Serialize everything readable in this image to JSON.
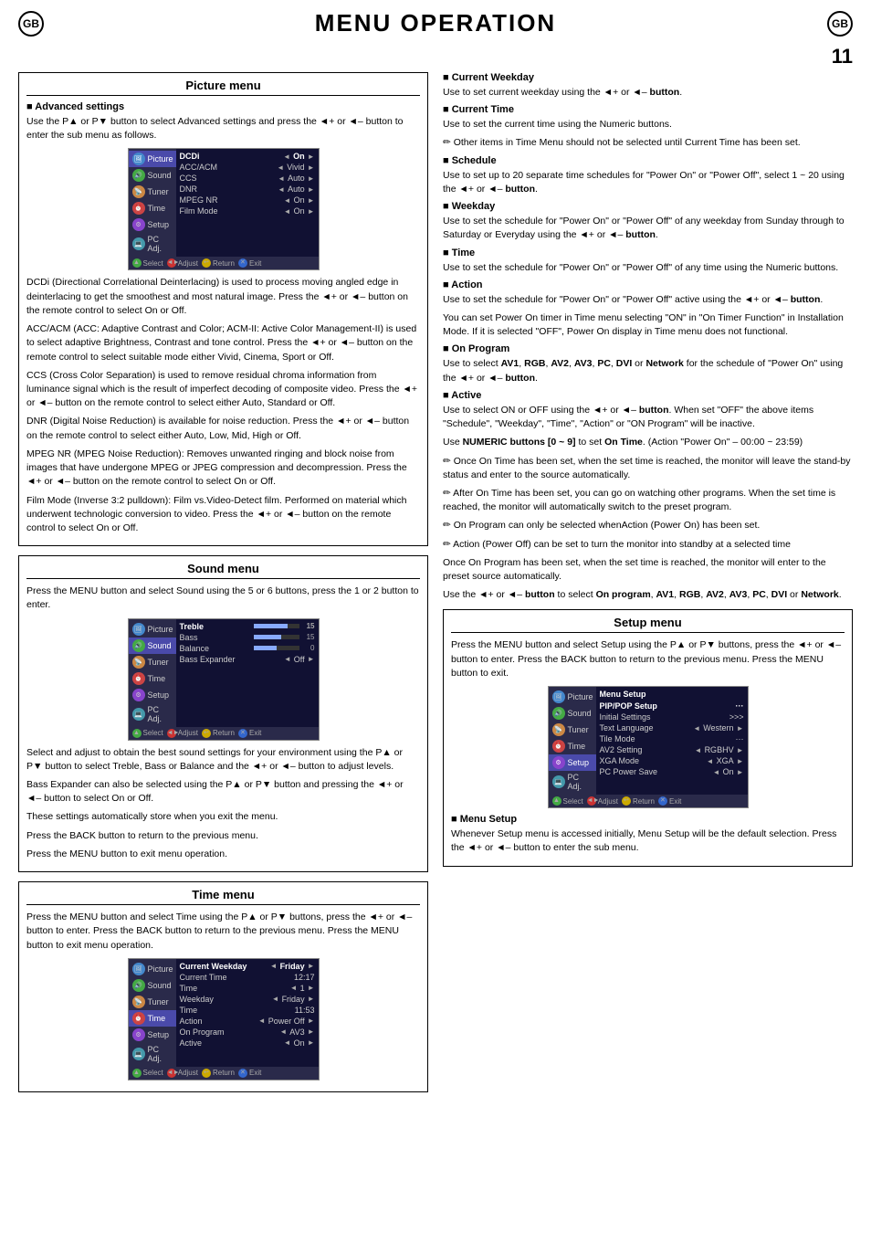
{
  "header": {
    "gb_label": "GB",
    "title": "MENU OPERATION",
    "page_number": "11"
  },
  "left_column": {
    "picture_menu": {
      "title": "Picture menu",
      "advanced_settings": {
        "heading": "Advanced settings",
        "intro": "Use the P▲ or P▼ button to select Advanced settings and press the ◄+ or ◄– button to enter the sub menu as follows.",
        "screenshot": {
          "active_tab": "Picture",
          "active_item": "DCDi",
          "rows": [
            {
              "label": "DCDi",
              "value": "On",
              "has_arrows": true
            },
            {
              "label": "ACC/ACM",
              "value": "Vivid",
              "has_arrows": true
            },
            {
              "label": "CCS",
              "value": "Auto",
              "has_arrows": true
            },
            {
              "label": "DNR",
              "value": "Auto",
              "has_arrows": true
            },
            {
              "label": "MPEG NR",
              "value": "On",
              "has_arrows": true
            },
            {
              "label": "Film Mode",
              "value": "On",
              "has_arrows": true
            }
          ]
        },
        "dcdi_text": "DCDi (Directional Correlational Deinterlacing) is used to process moving angled edge in deinterlacing to get the smoothest and most natural image. Press the ◄+ or ◄– button on the remote control to select On or Off.",
        "acc_acm_text": "ACC/ACM (ACC: Adaptive Contrast and Color; ACM-II: Active Color Management-II) is used to select adaptive Brightness, Contrast and tone control. Press the ◄+ or ◄– button on the remote control to select suitable mode either Vivid, Cinema, Sport or Off.",
        "ccs_text": "CCS (Cross Color Separation) is used to remove residual chroma information from luminance signal which is the result of imperfect decoding of composite video. Press the ◄+ or ◄– button on the remote control to select either Auto, Standard or Off.",
        "dnr_text": "DNR (Digital Noise Reduction) is available for noise reduction. Press the ◄+ or ◄– button on the remote control to select either Auto, Low, Mid, High or Off.",
        "mpeg_nr_text": "MPEG NR (MPEG Noise Reduction): Removes unwanted ringing and block noise from images that have undergone MPEG or JPEG compression and decompression. Press the ◄+ or ◄– button on the remote control to select On or Off.",
        "film_mode_text": "Film Mode (Inverse 3:2 pulldown): Film vs.Video-Detect film. Performed on material which underwent technologic conversion to video. Press the ◄+ or ◄– button on the remote control to select On or Off."
      }
    },
    "sound_menu": {
      "title": "Sound menu",
      "intro": "Press the MENU button and select Sound using the 5 or 6 buttons, press the 1 or 2 button to enter.",
      "screenshot": {
        "active_tab": "Sound",
        "rows": [
          {
            "label": "Treble",
            "bar": 75,
            "value": "15"
          },
          {
            "label": "Bass",
            "bar": 60,
            "value": "15"
          },
          {
            "label": "Balance",
            "bar": 50,
            "value": "0"
          },
          {
            "label": "Bass Expander",
            "value": "Off",
            "has_arrows": true
          }
        ]
      },
      "body_text": "Select and adjust to obtain the best sound settings for your environment using the P▲ or P▼ button to select Treble, Bass or Balance and the ◄+ or ◄– button to adjust levels.",
      "bass_expander_text": "Bass Expander can also be selected using the P▲ or P▼ button and pressing the ◄+ or ◄– button to select On or Off.",
      "auto_store_text": "These settings automatically store when you exit the menu.",
      "back_button_text": "Press the BACK button to return to the previous menu.",
      "menu_button_text": "Press the MENU button to exit menu operation."
    },
    "time_menu": {
      "title": "Time menu",
      "intro": "Press the MENU button and select Time using the P▲ or P▼ buttons, press the ◄+ or ◄– button to enter. Press the BACK button to return to the previous menu. Press the MENU button to exit menu operation.",
      "screenshot": {
        "active_tab": "Time",
        "rows": [
          {
            "label": "Current Weekday",
            "value": "Friday",
            "has_arrows": true
          },
          {
            "label": "Current Time",
            "value": "12:17"
          },
          {
            "label": "Time",
            "value": "1"
          },
          {
            "label": "Weekday",
            "value": "Friday",
            "has_arrows": true
          },
          {
            "label": "Time",
            "value": "11:53"
          },
          {
            "label": "Action",
            "value": "Power Off",
            "has_arrows": true
          },
          {
            "label": "On Program",
            "value": "AV3",
            "has_arrows": true
          },
          {
            "label": "Active",
            "value": "On",
            "has_arrows": true
          }
        ]
      }
    }
  },
  "right_column": {
    "time_menu_items": [
      {
        "heading": "Current Weekday",
        "text": "Use to set current weekday using the ◄+ or ◄– button."
      },
      {
        "heading": "Current Time",
        "text": "Use to set the current time using the Numeric buttons.",
        "note": "Other items in Time Menu should not be selected until Current Time has been set."
      },
      {
        "heading": "Schedule",
        "text": "Use to set up to 20 separate time schedules for \"Power On\" or \"Power Off\", select 1 ~ 20 using the ◄+ or ◄– button."
      },
      {
        "heading": "Weekday",
        "text": "Use to set the schedule for \"Power On\" or \"Power Off\" of any weekday from Sunday through to Saturday or Everyday using the ◄+ or ◄– button."
      },
      {
        "heading": "Time",
        "text": "Use to set the schedule for \"Power On\" or \"Power Off\" of any time using the Numeric buttons."
      },
      {
        "heading": "Action",
        "text": "Use to set the schedule for \"Power On\" or \"Power Off\" active using the ◄+ or ◄– button.",
        "extra": "You can set Power On timer in Time menu selecting \"ON\" in \"On Timer Function\" in Installation Mode. If it is selected \"OFF\", Power On display in Time menu does not functional."
      },
      {
        "heading": "On Program",
        "text": "Use to select AV1, RGB, AV2, AV3, PC, DVI or Network for the schedule of \"Power On\" using the ◄+ or ◄– button."
      },
      {
        "heading": "Active",
        "text": "Use to select ON or OFF using the ◄+ or ◄– button. When set \"OFF\" the above items \"Schedule\", \"Weekday\", \"Time\", \"Action\" or \"ON Program\" will be inactive.",
        "extra2": "Use NUMERIC buttons [0 ~ 9] to set On Time. (Action \"Power On\" – 00:00 ~ 23:59)",
        "notes": [
          "Once On Time has been set, when the set time is reached, the monitor will leave the stand-by status and enter to the source automatically.",
          "After On Time has been set, you can go on watching other programs. When the set time is reached, the monitor will automatically switch to the preset program.",
          "On Program can only be selected whenAction (Power On) has been set.",
          "Action (Power Off) can be set to turn the monitor into standby at a selected time"
        ],
        "final_text": "Once On Program has been set, when the set time is reached, the monitor will enter to the preset source automatically.",
        "select_text": "Use the ◄+ or ◄– button to select On program, AV1, RGB, AV2, AV3, PC, DVI or Network."
      }
    ],
    "setup_menu": {
      "title": "Setup menu",
      "intro": "Press the MENU button and select Setup using the P▲ or P▼ buttons, press the ◄+ or ◄– button to enter. Press the BACK button to return to the previous menu. Press the MENU button to exit.",
      "screenshot": {
        "active_tab": "Setup",
        "title": "Menu Setup",
        "rows": [
          {
            "label": "PIP/POP Setup",
            "value": "···"
          },
          {
            "label": "Initial Settings",
            "value": ">>>"
          },
          {
            "label": "Text Language",
            "arrow_left": "◄",
            "value": "Western",
            "arrow_right": "►"
          },
          {
            "label": "Tile Mode",
            "value": "···"
          },
          {
            "label": "AV2 Setting",
            "arrow_left": "◄",
            "value": "RGBHV",
            "arrow_right": "►"
          },
          {
            "label": "XGA Mode",
            "arrow_left": "◄",
            "value": "XGA",
            "arrow_right": "►"
          },
          {
            "label": "PC Power Save",
            "arrow_left": "◄",
            "value": "On",
            "arrow_right": "►"
          }
        ]
      },
      "menu_setup_heading": "Menu Setup",
      "menu_setup_text": "Whenever Setup menu is accessed initially, Menu Setup will be the default selection. Press the ◄+ or ◄– button to enter the sub menu."
    }
  }
}
